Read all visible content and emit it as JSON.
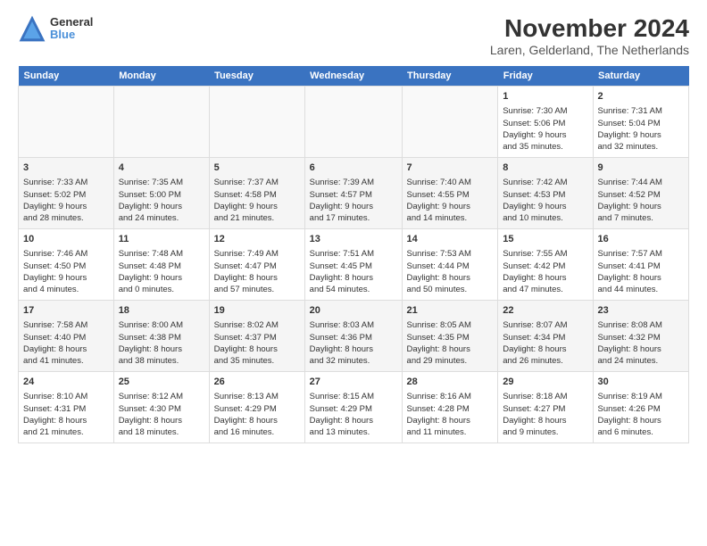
{
  "logo": {
    "line1": "General",
    "line2": "Blue"
  },
  "title": "November 2024",
  "subtitle": "Laren, Gelderland, The Netherlands",
  "headers": [
    "Sunday",
    "Monday",
    "Tuesday",
    "Wednesday",
    "Thursday",
    "Friday",
    "Saturday"
  ],
  "weeks": [
    [
      {
        "day": "",
        "info": ""
      },
      {
        "day": "",
        "info": ""
      },
      {
        "day": "",
        "info": ""
      },
      {
        "day": "",
        "info": ""
      },
      {
        "day": "",
        "info": ""
      },
      {
        "day": "1",
        "info": "Sunrise: 7:30 AM\nSunset: 5:06 PM\nDaylight: 9 hours\nand 35 minutes."
      },
      {
        "day": "2",
        "info": "Sunrise: 7:31 AM\nSunset: 5:04 PM\nDaylight: 9 hours\nand 32 minutes."
      }
    ],
    [
      {
        "day": "3",
        "info": "Sunrise: 7:33 AM\nSunset: 5:02 PM\nDaylight: 9 hours\nand 28 minutes."
      },
      {
        "day": "4",
        "info": "Sunrise: 7:35 AM\nSunset: 5:00 PM\nDaylight: 9 hours\nand 24 minutes."
      },
      {
        "day": "5",
        "info": "Sunrise: 7:37 AM\nSunset: 4:58 PM\nDaylight: 9 hours\nand 21 minutes."
      },
      {
        "day": "6",
        "info": "Sunrise: 7:39 AM\nSunset: 4:57 PM\nDaylight: 9 hours\nand 17 minutes."
      },
      {
        "day": "7",
        "info": "Sunrise: 7:40 AM\nSunset: 4:55 PM\nDaylight: 9 hours\nand 14 minutes."
      },
      {
        "day": "8",
        "info": "Sunrise: 7:42 AM\nSunset: 4:53 PM\nDaylight: 9 hours\nand 10 minutes."
      },
      {
        "day": "9",
        "info": "Sunrise: 7:44 AM\nSunset: 4:52 PM\nDaylight: 9 hours\nand 7 minutes."
      }
    ],
    [
      {
        "day": "10",
        "info": "Sunrise: 7:46 AM\nSunset: 4:50 PM\nDaylight: 9 hours\nand 4 minutes."
      },
      {
        "day": "11",
        "info": "Sunrise: 7:48 AM\nSunset: 4:48 PM\nDaylight: 9 hours\nand 0 minutes."
      },
      {
        "day": "12",
        "info": "Sunrise: 7:49 AM\nSunset: 4:47 PM\nDaylight: 8 hours\nand 57 minutes."
      },
      {
        "day": "13",
        "info": "Sunrise: 7:51 AM\nSunset: 4:45 PM\nDaylight: 8 hours\nand 54 minutes."
      },
      {
        "day": "14",
        "info": "Sunrise: 7:53 AM\nSunset: 4:44 PM\nDaylight: 8 hours\nand 50 minutes."
      },
      {
        "day": "15",
        "info": "Sunrise: 7:55 AM\nSunset: 4:42 PM\nDaylight: 8 hours\nand 47 minutes."
      },
      {
        "day": "16",
        "info": "Sunrise: 7:57 AM\nSunset: 4:41 PM\nDaylight: 8 hours\nand 44 minutes."
      }
    ],
    [
      {
        "day": "17",
        "info": "Sunrise: 7:58 AM\nSunset: 4:40 PM\nDaylight: 8 hours\nand 41 minutes."
      },
      {
        "day": "18",
        "info": "Sunrise: 8:00 AM\nSunset: 4:38 PM\nDaylight: 8 hours\nand 38 minutes."
      },
      {
        "day": "19",
        "info": "Sunrise: 8:02 AM\nSunset: 4:37 PM\nDaylight: 8 hours\nand 35 minutes."
      },
      {
        "day": "20",
        "info": "Sunrise: 8:03 AM\nSunset: 4:36 PM\nDaylight: 8 hours\nand 32 minutes."
      },
      {
        "day": "21",
        "info": "Sunrise: 8:05 AM\nSunset: 4:35 PM\nDaylight: 8 hours\nand 29 minutes."
      },
      {
        "day": "22",
        "info": "Sunrise: 8:07 AM\nSunset: 4:34 PM\nDaylight: 8 hours\nand 26 minutes."
      },
      {
        "day": "23",
        "info": "Sunrise: 8:08 AM\nSunset: 4:32 PM\nDaylight: 8 hours\nand 24 minutes."
      }
    ],
    [
      {
        "day": "24",
        "info": "Sunrise: 8:10 AM\nSunset: 4:31 PM\nDaylight: 8 hours\nand 21 minutes."
      },
      {
        "day": "25",
        "info": "Sunrise: 8:12 AM\nSunset: 4:30 PM\nDaylight: 8 hours\nand 18 minutes."
      },
      {
        "day": "26",
        "info": "Sunrise: 8:13 AM\nSunset: 4:29 PM\nDaylight: 8 hours\nand 16 minutes."
      },
      {
        "day": "27",
        "info": "Sunrise: 8:15 AM\nSunset: 4:29 PM\nDaylight: 8 hours\nand 13 minutes."
      },
      {
        "day": "28",
        "info": "Sunrise: 8:16 AM\nSunset: 4:28 PM\nDaylight: 8 hours\nand 11 minutes."
      },
      {
        "day": "29",
        "info": "Sunrise: 8:18 AM\nSunset: 4:27 PM\nDaylight: 8 hours\nand 9 minutes."
      },
      {
        "day": "30",
        "info": "Sunrise: 8:19 AM\nSunset: 4:26 PM\nDaylight: 8 hours\nand 6 minutes."
      }
    ]
  ]
}
